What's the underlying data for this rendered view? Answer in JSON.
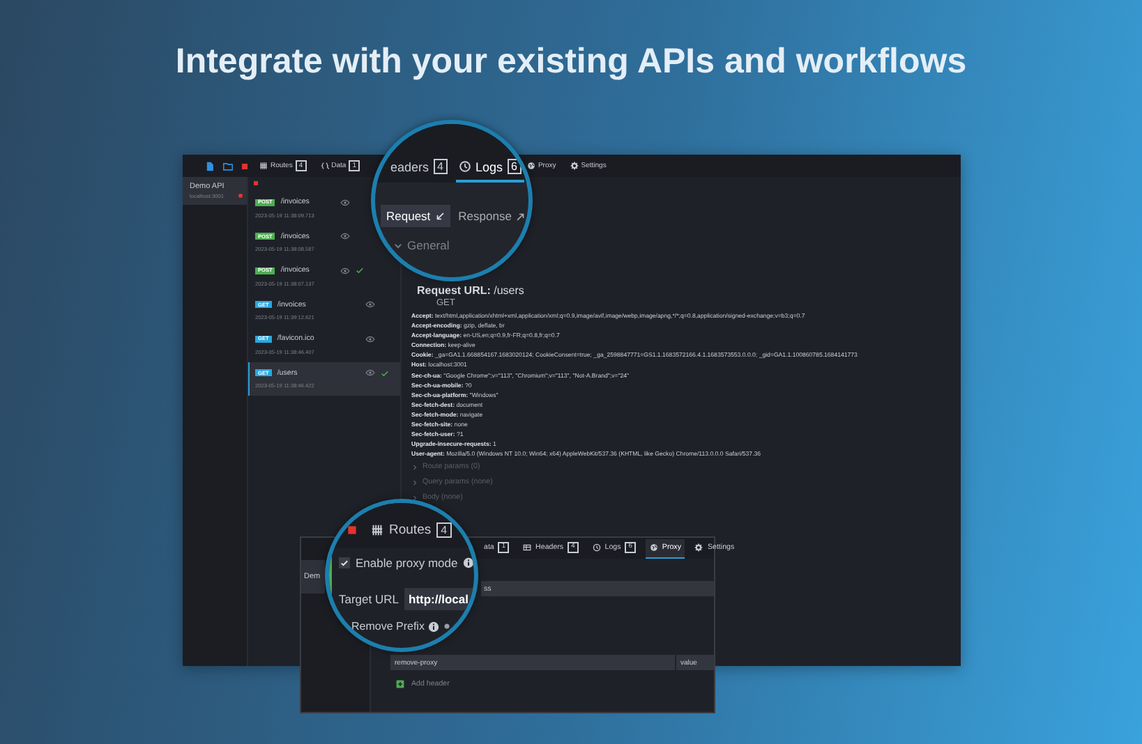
{
  "headline": "Integrate with your existing APIs and workflows",
  "main_window": {
    "toolbar_tabs": [
      {
        "label": "Routes",
        "count": "4",
        "selected": false
      },
      {
        "label": "Data",
        "count": "1",
        "selected": false
      },
      {
        "label": "Proxy",
        "selected": false
      },
      {
        "label": "Settings",
        "selected": false
      }
    ],
    "environments": [
      {
        "name": "Demo API",
        "address": "localhost:3001",
        "selected": true
      }
    ],
    "logs": [
      {
        "method": "POST",
        "color": "#4caf50",
        "path": "/invoices",
        "time": "2023-05-19 11:38:09.713",
        "matched": false,
        "selected": false
      },
      {
        "method": "POST",
        "color": "#4caf50",
        "path": "/invoices",
        "time": "2023-05-19 11:38:08.587",
        "matched": false,
        "selected": false
      },
      {
        "method": "POST",
        "color": "#4caf50",
        "path": "/invoices",
        "time": "2023-05-19 11:38:07.137",
        "matched": true,
        "selected": false
      },
      {
        "method": "GET",
        "color": "#29a8e0",
        "path": "/invoices",
        "time": "2023-05-19 11:39:12.621",
        "matched": false,
        "selected": false
      },
      {
        "method": "GET",
        "color": "#29a8e0",
        "path": "/favicon.ico",
        "time": "2023-05-19 11:38:46.407",
        "matched": false,
        "selected": false
      },
      {
        "method": "GET",
        "color": "#29a8e0",
        "path": "/users",
        "time": "2023-05-19 11:38:46.422",
        "matched": true,
        "selected": true
      }
    ],
    "detail": {
      "request_url_label": "Request URL:",
      "request_url": "/users",
      "method": "GET",
      "headers": [
        {
          "name": "Accept:",
          "value": "text/html,application/xhtml+xml,application/xml;q=0.9,image/avif,image/webp,image/apng,*/*;q=0.8,application/signed-exchange;v=b3;q=0.7"
        },
        {
          "name": "Accept-encoding:",
          "value": "gzip, deflate, br"
        },
        {
          "name": "Accept-language:",
          "value": "en-US,en;q=0.9,fr-FR;q=0.8,fr;q=0.7"
        },
        {
          "name": "Connection:",
          "value": "keep-alive"
        },
        {
          "name": "Cookie:",
          "value": "_ga=GA1.1.668854167.1683020124; CookieConsent=true; _ga_2598847771=GS1.1.1683572166.4.1.1683573553.0.0.0; _gid=GA1.1.100860785.1684141773"
        },
        {
          "name": "Host:",
          "value": "localhost:3001"
        },
        {
          "name": "Sec-ch-ua:",
          "value": "\"Google Chrome\";v=\"113\", \"Chromium\";v=\"113\", \"Not-A.Brand\";v=\"24\""
        },
        {
          "name": "Sec-ch-ua-mobile:",
          "value": "?0"
        },
        {
          "name": "Sec-ch-ua-platform:",
          "value": "\"Windows\""
        },
        {
          "name": "Sec-fetch-dest:",
          "value": "document"
        },
        {
          "name": "Sec-fetch-mode:",
          "value": "navigate"
        },
        {
          "name": "Sec-fetch-site:",
          "value": "none"
        },
        {
          "name": "Sec-fetch-user:",
          "value": "?1"
        },
        {
          "name": "Upgrade-insecure-requests:",
          "value": "1"
        },
        {
          "name": "User-agent:",
          "value": "Mozilla/5.0 (Windows NT 10.0; Win64; x64) AppleWebKit/537.36 (KHTML, like Gecko) Chrome/113.0.0.0 Safari/537.36"
        }
      ],
      "sections": [
        {
          "label": "Route params (0)",
          "expanded": false
        },
        {
          "label": "Query params (none)",
          "expanded": false
        },
        {
          "label": "Body (none)",
          "expanded": false
        }
      ]
    }
  },
  "logs_lens": {
    "tabs": [
      {
        "label": "eaders",
        "count": "4",
        "selected": false
      },
      {
        "label": "Logs",
        "count": "6",
        "selected": true
      }
    ],
    "subtabs": [
      {
        "kind": "request",
        "label": "Request",
        "selected": true
      },
      {
        "kind": "response",
        "label": "Response",
        "selected": false
      }
    ],
    "section": {
      "label": "General",
      "expanded": true
    }
  },
  "proxy_window": {
    "tabs": [
      {
        "label": "ata",
        "count": "1",
        "selected": false
      },
      {
        "label": "Headers",
        "count": "4",
        "selected": false
      },
      {
        "label": "Logs",
        "count": "6",
        "selected": false
      },
      {
        "label": "Proxy",
        "selected": true
      },
      {
        "label": "Settings",
        "selected": false
      }
    ],
    "environment": "Dem",
    "target_url_tail": "ss",
    "columns": [
      "remove-proxy",
      "value"
    ],
    "add_header": "Add header"
  },
  "proxy_lens": {
    "tab": {
      "label": "Routes",
      "count": "4"
    },
    "enable_proxy": {
      "label": "Enable proxy mode",
      "checked": true
    },
    "target_url": {
      "label": "Target URL",
      "value": "http://local"
    },
    "remove_prefix": {
      "label": "Remove Prefix"
    }
  }
}
